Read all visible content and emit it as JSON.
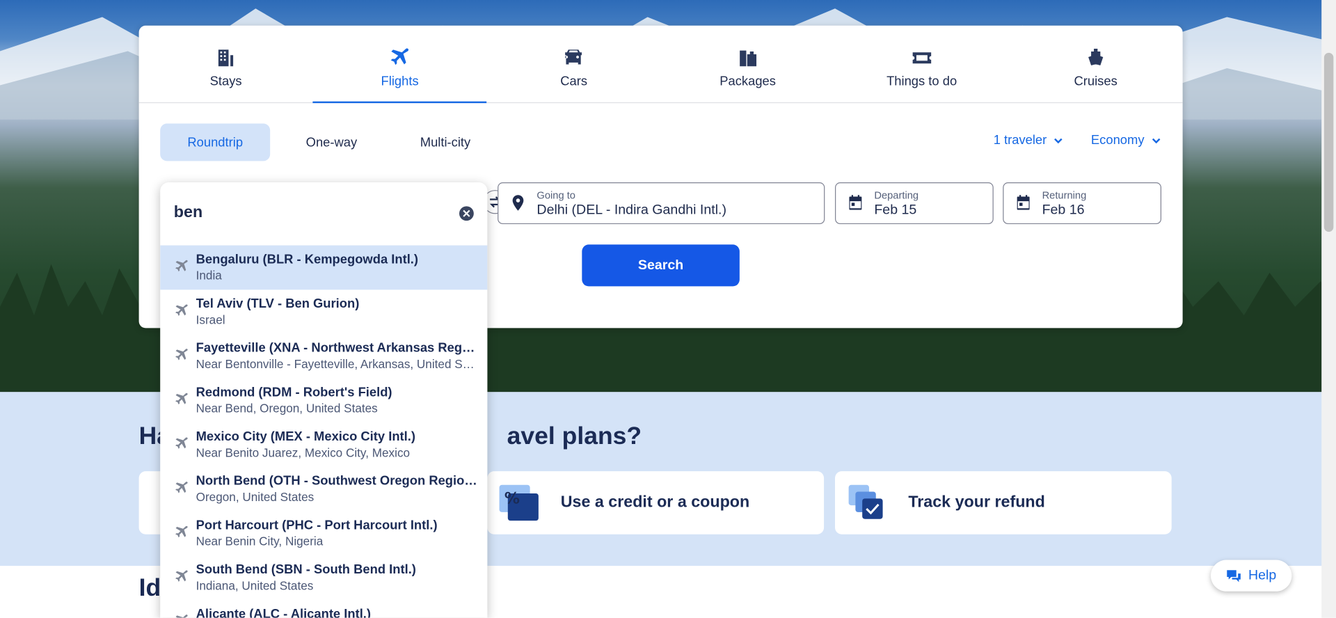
{
  "tabs": [
    {
      "label": "Stays",
      "icon": "building-icon"
    },
    {
      "label": "Flights",
      "icon": "plane-icon",
      "active": true
    },
    {
      "label": "Cars",
      "icon": "car-icon"
    },
    {
      "label": "Packages",
      "icon": "packages-icon"
    },
    {
      "label": "Things to do",
      "icon": "ticket-icon"
    },
    {
      "label": "Cruises",
      "icon": "ship-icon"
    }
  ],
  "trip_types": [
    "Roundtrip",
    "One-way",
    "Multi-city"
  ],
  "travelers": "1 traveler",
  "cabin": "Economy",
  "going_to": {
    "caption": "Going to",
    "value": "Delhi (DEL - Indira Gandhi Intl.)"
  },
  "departing": {
    "caption": "Departing",
    "value": "Feb 15"
  },
  "returning": {
    "caption": "Returning",
    "value": "Feb 16"
  },
  "search_label": "Search",
  "dropdown": {
    "query": "ben",
    "items": [
      {
        "name": "Bengaluru (BLR - Kempegowda Intl.)",
        "sub": "India"
      },
      {
        "name": "Tel Aviv (TLV - Ben Gurion)",
        "sub": "Israel"
      },
      {
        "name": "Fayetteville (XNA - Northwest Arkansas Regional)",
        "sub": "Near Bentonville - Fayetteville, Arkansas, United States"
      },
      {
        "name": "Redmond (RDM - Robert's Field)",
        "sub": "Near Bend, Oregon, United States"
      },
      {
        "name": "Mexico City (MEX - Mexico City Intl.)",
        "sub": "Near Benito Juarez, Mexico City, Mexico"
      },
      {
        "name": "North Bend (OTH - Southwest Oregon Regional)",
        "sub": "Oregon, United States"
      },
      {
        "name": "Port Harcourt (PHC - Port Harcourt Intl.)",
        "sub": "Near Benin City, Nigeria"
      },
      {
        "name": "South Bend (SBN - South Bend Intl.)",
        "sub": "Indiana, United States"
      },
      {
        "name": "Alicante (ALC - Alicante Intl.)",
        "sub": ""
      }
    ]
  },
  "band": {
    "heading_left": "Ha",
    "heading_right": "avel plans?",
    "cards": [
      "Use a credit or a coupon",
      "Track your refund"
    ]
  },
  "lower_heading": "Id",
  "help_label": "Help"
}
